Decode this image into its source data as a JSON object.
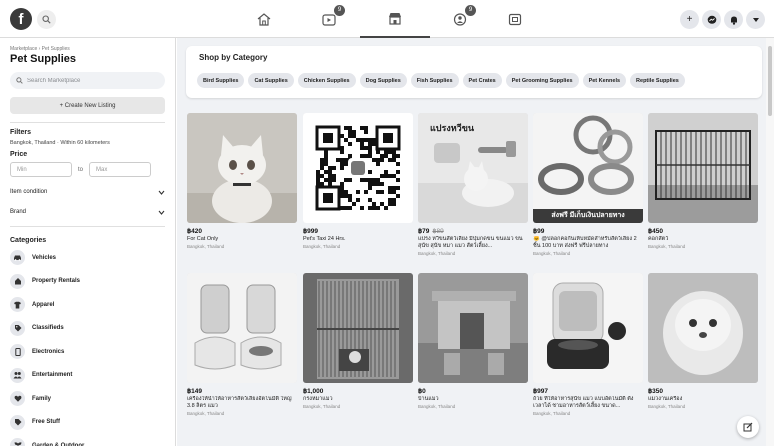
{
  "topbar": {
    "logo": "f",
    "nav": [
      {
        "name": "home-icon",
        "badge": ""
      },
      {
        "name": "watch-icon",
        "badge": "9"
      },
      {
        "name": "marketplace-icon",
        "badge": ""
      },
      {
        "name": "groups-icon",
        "badge": "9"
      },
      {
        "name": "gaming-icon",
        "badge": ""
      }
    ],
    "right": [
      "+",
      "messenger-icon",
      "bell-icon",
      "chevron-down-icon"
    ]
  },
  "sidebar": {
    "breadcrumb": "Marketplace › Pet Supplies",
    "title": "Pet Supplies",
    "search_placeholder": "Search Marketplace",
    "create_label": "+ Create New Listing",
    "filters_heading": "Filters",
    "location": "Bangkok, Thailand · Within 60 kilometers",
    "price_heading": "Price",
    "min_placeholder": "Min",
    "to_label": "to",
    "max_placeholder": "Max",
    "item_condition": "Item condition",
    "brand": "Brand",
    "categories_heading": "Categories",
    "categories": [
      {
        "label": "Vehicles",
        "icon": "car-icon"
      },
      {
        "label": "Property Rentals",
        "icon": "house-icon"
      },
      {
        "label": "Apparel",
        "icon": "shirt-icon"
      },
      {
        "label": "Classifieds",
        "icon": "tag-icon"
      },
      {
        "label": "Electronics",
        "icon": "phone-icon"
      },
      {
        "label": "Entertainment",
        "icon": "people-icon"
      },
      {
        "label": "Family",
        "icon": "heart-icon"
      },
      {
        "label": "Free Stuff",
        "icon": "free-tag-icon"
      },
      {
        "label": "Garden & Outdoor",
        "icon": "garden-icon"
      }
    ]
  },
  "shop": {
    "title": "Shop by Category",
    "chips": [
      "Bird Supplies",
      "Cat Supplies",
      "Chicken Supplies",
      "Dog Supplies",
      "Fish Supplies",
      "Pet Crates",
      "Pet Grooming Supplies",
      "Pet Kennels",
      "Reptile Supplies"
    ]
  },
  "listings": [
    {
      "price": "฿420",
      "old_price": "",
      "title": "For Cat Only",
      "location": "Bangkok, Thailand",
      "image": "cat-photo"
    },
    {
      "price": "฿999",
      "old_price": "",
      "title": "Pet's Taxi 24 Hrs.",
      "location": "Bangkok, Thailand",
      "image": "qr-code"
    },
    {
      "price": "฿79",
      "old_price": "฿89",
      "title": "แปรง หวีขนสัตว์เลี้ยง มีปุ่มกดขน ขนแมว ขนสุนัข สุนัข หมา แมว สัตว์เลี้ยง...",
      "location": "Bangkok, Thailand",
      "image": "brush-ad",
      "image_text": "แปรงหวีขน"
    },
    {
      "price": "฿99",
      "old_price": "",
      "title": "🐱 @ปลอกคอกันเห็บหมัดสำหรับสัตว์เลี้ยง 2 ชิ้น 100 บาท ส่งฟรี ฟรีปลายทาง",
      "location": "Bangkok, Thailand",
      "image": "collar-ad",
      "image_text": "ส่งฟรี มีเก็บเงินปลายทาง"
    },
    {
      "price": "฿450",
      "old_price": "",
      "title": "คอกสัตว์",
      "location": "Bangkok, Thailand",
      "image": "pen-photo"
    },
    {
      "price": "฿149",
      "old_price": "",
      "title": "เครื่องให้น้ำให้อาหารสัตว์เลี้ยงอัตโนมัติ ใหญ่ 3.8 ลิตร แมว",
      "location": "Bangkok, Thailand",
      "image": "feeder-photo"
    },
    {
      "price": "฿1,000",
      "old_price": "",
      "title": "กรงหมาแมว",
      "location": "Bangkok, Thailand",
      "image": "cage-photo"
    },
    {
      "price": "฿0",
      "old_price": "",
      "title": "บ้านแมว",
      "location": "Bangkok, Thailand",
      "image": "cathouse-photo"
    },
    {
      "price": "฿997",
      "old_price": "",
      "title": "ถ้วย ที่ให้อาหารสุนัข แมว แบบอัตโนมัติ ตั้งเวลาได้ ชามอาหารสัตว์เลี้ยง ขนาด...",
      "location": "Bangkok, Thailand",
      "image": "autofeeder-photo"
    },
    {
      "price": "฿350",
      "old_price": "",
      "title": "แมวงานเครื่อง",
      "location": "Bangkok, Thailand",
      "image": "fluffy-photo"
    }
  ]
}
